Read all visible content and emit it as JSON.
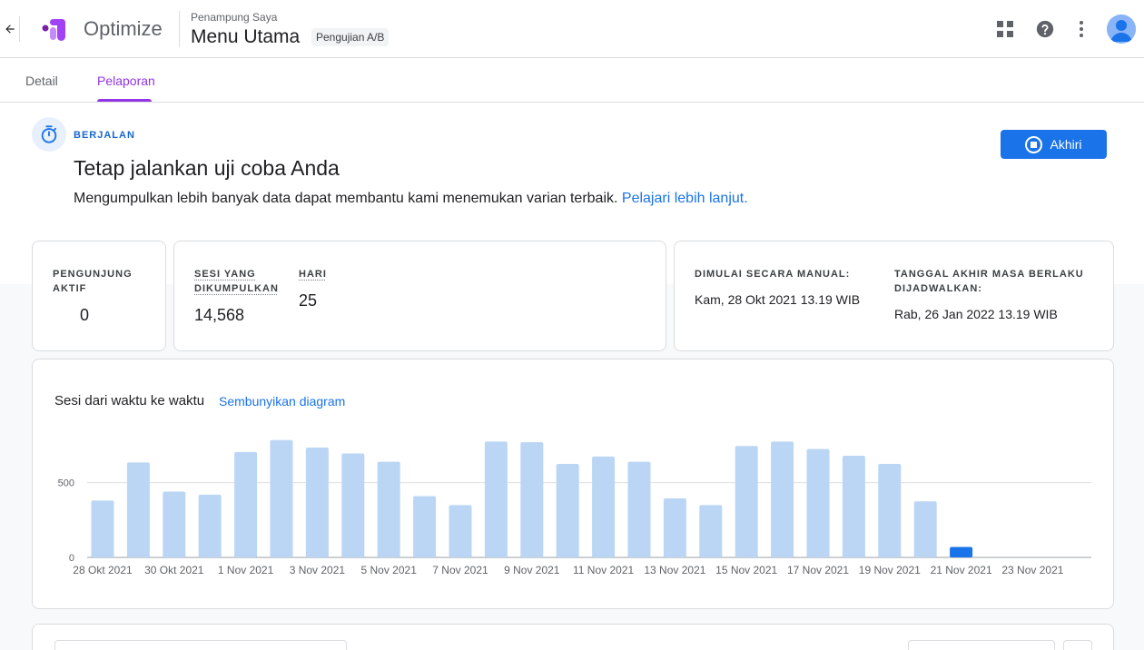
{
  "header": {
    "app_name": "Optimize",
    "container_name": "Penampung Saya",
    "page_title": "Menu Utama",
    "type_chip": "Pengujian A/B",
    "icons": [
      "back-arrow-icon",
      "apps-grid-icon",
      "help-icon",
      "more-vert-icon",
      "avatar"
    ]
  },
  "tabs": [
    {
      "label": "Detail",
      "active": false
    },
    {
      "label": "Pelaporan",
      "active": true
    }
  ],
  "status": {
    "label": "BERJALAN",
    "title": "Tetap jalankan uji coba Anda",
    "description": "Mengumpulkan lebih banyak data dapat membantu kami menemukan varian terbaik.",
    "learn_more": "Pelajari lebih lanjut.",
    "end_button": "Akhiri"
  },
  "stats": {
    "active_visitors": {
      "label_line1": "PENGUNJUNG",
      "label_line2": "AKTIF",
      "value": "0"
    },
    "sessions": {
      "label_line1": "SESI YANG",
      "label_line2": "DIKUMPULKAN",
      "value": "14,568"
    },
    "days": {
      "label": "HARI",
      "value": "25"
    },
    "start": {
      "label": "DIMULAI SECARA MANUAL:",
      "value": "Kam, 28 Okt 2021 13.19 WIB"
    },
    "end": {
      "label_line1": "TANGGAL AKHIR MASA BERLAKU",
      "label_line2": "DIJADWALKAN:",
      "value": "Rab, 26 Jan 2022 13.19 WIB"
    }
  },
  "chart_section": {
    "title": "Sesi dari waktu ke waktu",
    "hide_link": "Sembunyikan diagram"
  },
  "colors": {
    "accent": "#9334e6",
    "primary": "#1a73e8",
    "bar": "#bbd6f5",
    "bar_current": "#1a73e8"
  },
  "chart_data": {
    "type": "bar",
    "categories": [
      "28 Okt 2021",
      "29 Okt 2021",
      "30 Okt 2021",
      "31 Okt 2021",
      "1 Nov 2021",
      "2 Nov 2021",
      "3 Nov 2021",
      "4 Nov 2021",
      "5 Nov 2021",
      "6 Nov 2021",
      "7 Nov 2021",
      "8 Nov 2021",
      "9 Nov 2021",
      "10 Nov 2021",
      "11 Nov 2021",
      "12 Nov 2021",
      "13 Nov 2021",
      "14 Nov 2021",
      "15 Nov 2021",
      "16 Nov 2021",
      "17 Nov 2021",
      "18 Nov 2021",
      "19 Nov 2021",
      "20 Nov 2021",
      "21 Nov 2021",
      "22 Nov 2021",
      "23 Nov 2021"
    ],
    "values": [
      380,
      635,
      440,
      420,
      705,
      785,
      735,
      695,
      640,
      410,
      350,
      775,
      770,
      625,
      675,
      640,
      395,
      350,
      745,
      775,
      725,
      680,
      625,
      375,
      70,
      0,
      0
    ],
    "highlight_index": 24,
    "x_tick_labels": [
      "28 Okt 2021",
      "30 Okt 2021",
      "1 Nov 2021",
      "3 Nov 2021",
      "5 Nov 2021",
      "7 Nov 2021",
      "9 Nov 2021",
      "11 Nov 2021",
      "13 Nov 2021",
      "15 Nov 2021",
      "17 Nov 2021",
      "19 Nov 2021",
      "21 Nov 2021",
      "23 Nov 2021"
    ],
    "y_ticks": [
      0,
      500
    ],
    "ylim": [
      0,
      850
    ],
    "grid": true,
    "title": "Sesi dari waktu ke waktu",
    "xlabel": "",
    "ylabel": ""
  }
}
